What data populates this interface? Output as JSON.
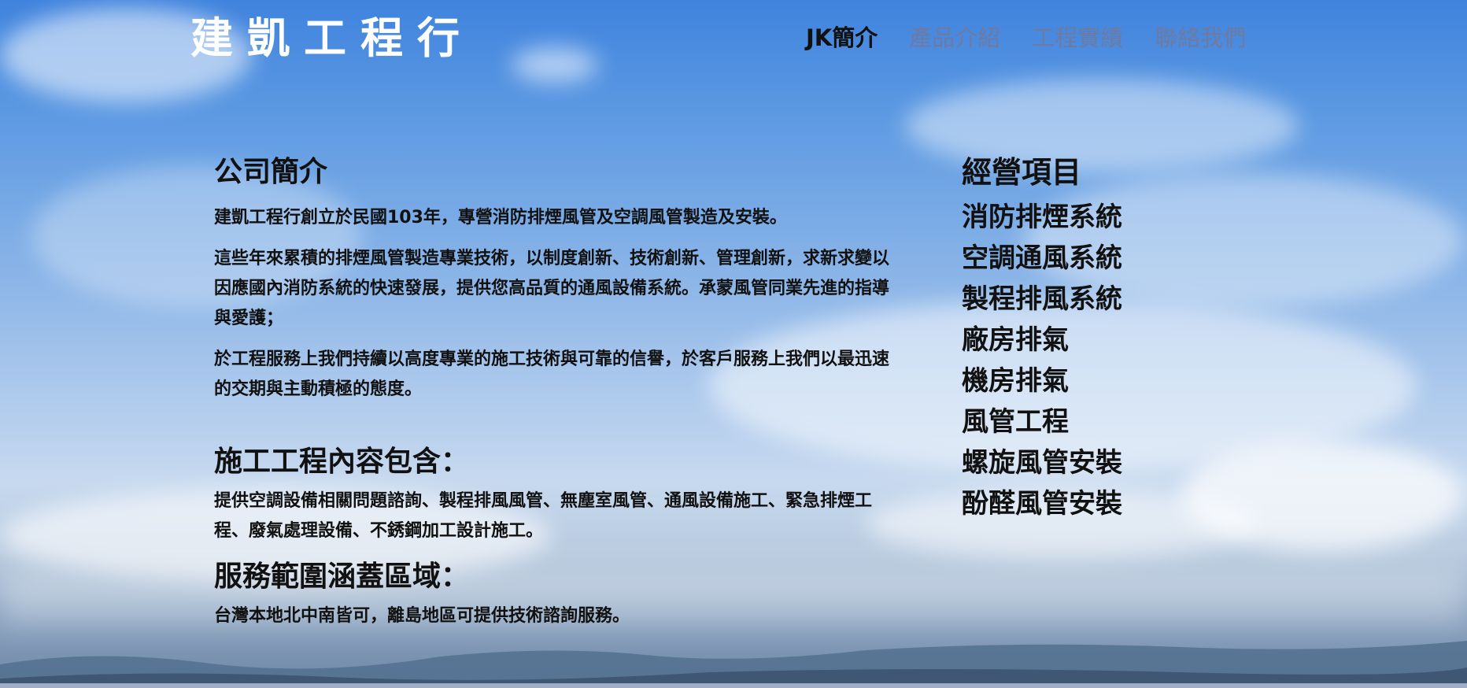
{
  "header": {
    "logo_text": "建凱工程行",
    "nav": [
      {
        "label": "JK簡介",
        "active": true
      },
      {
        "label": "產品介紹",
        "active": false
      },
      {
        "label": "工程實績",
        "active": false
      },
      {
        "label": "聯絡我們",
        "active": false
      }
    ]
  },
  "intro": {
    "title": "公司簡介",
    "paragraphs": [
      "建凱工程行創立於民國103年，專營消防排煙風管及空調風管製造及安裝。",
      "這些年來累積的排煙風管製造專業技術，以制度創新、技術創新、管理創新，求新求變以因應國內消防系統的快速發展，提供您高品質的通風設備系統。承蒙風管同業先進的指導與愛護；",
      "於工程服務上我們持續以高度專業的施工技術與可靠的信譽，於客戶服務上我們以最迅速的交期與主動積極的態度。"
    ]
  },
  "construction": {
    "title": "施工工程內容包含：",
    "text": "提供空調設備相關問題諮詢、製程排風風管、無塵室風管、通風設備施工、緊急排煙工程、廢氣處理設備、不銹鋼加工設計施工。"
  },
  "service_area": {
    "title": "服務範圍涵蓋區域：",
    "text": "台灣本地北中南皆可，離島地區可提供技術諮詢服務。"
  },
  "business": {
    "title": "經營項目",
    "items": [
      "消防排煙系統",
      "空調通風系統",
      "製程排風系統",
      "廠房排氣",
      "機房排氣",
      "風管工程",
      "螺旋風管安裝",
      "酚醛風管安裝"
    ]
  },
  "colors": {
    "sky": "#5f9be3",
    "nav_inactive": "#6e7aa0",
    "nav_active": "#111111",
    "logo": "#ffffff"
  }
}
